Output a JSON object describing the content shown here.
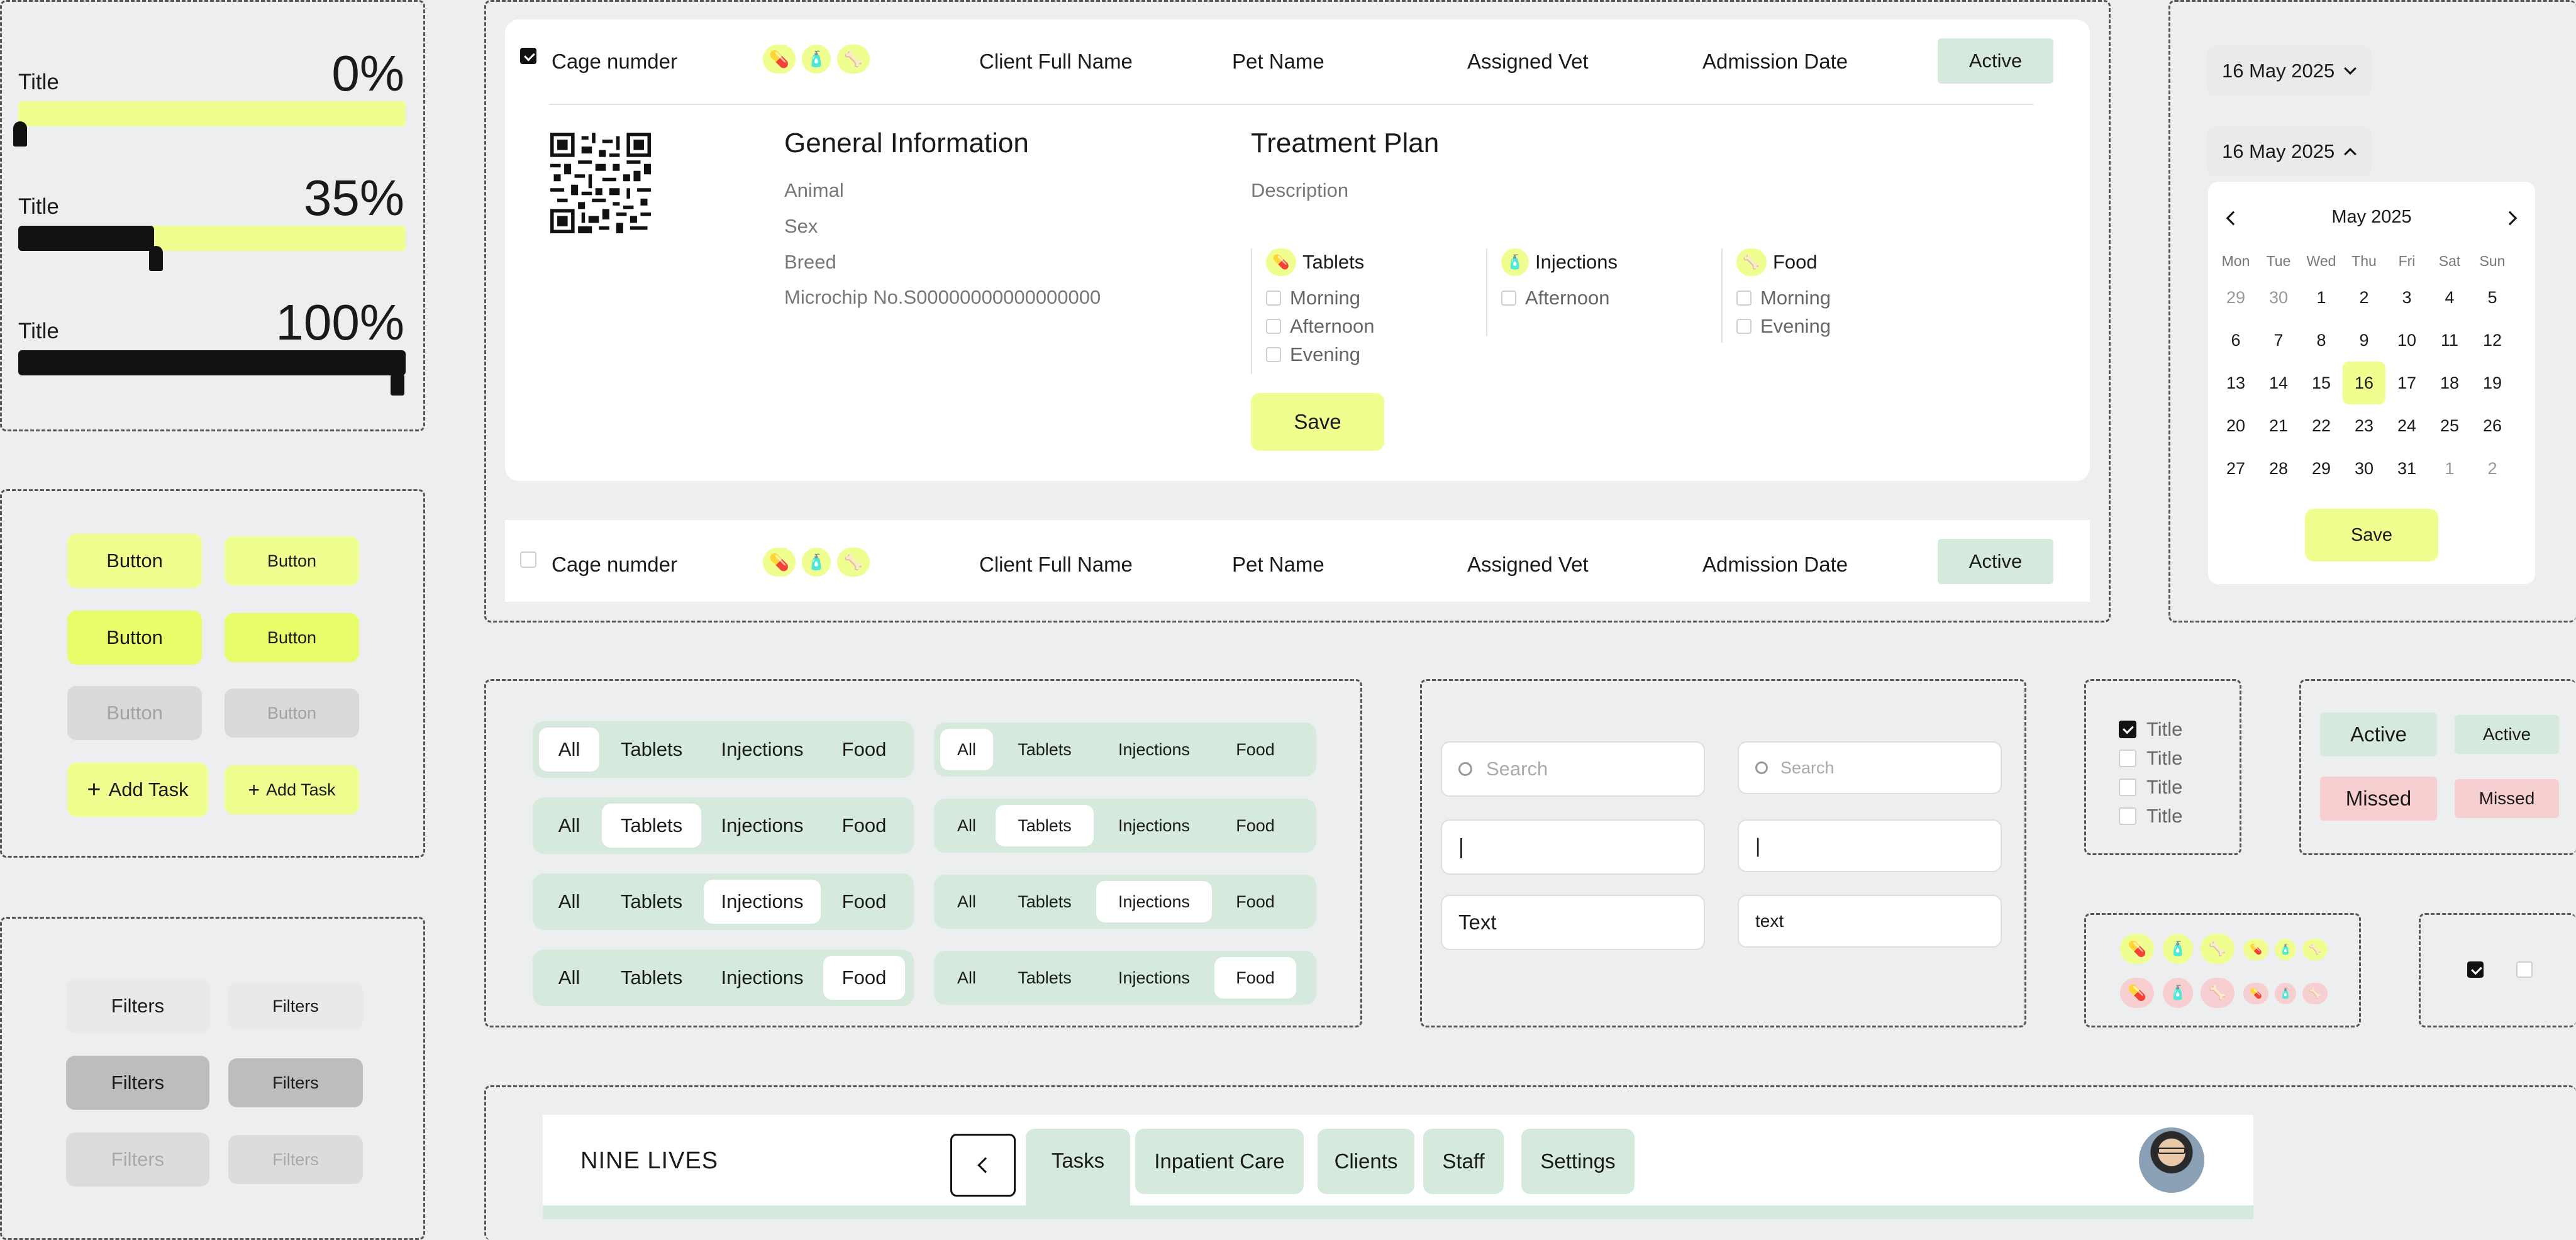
{
  "progress": {
    "bars": [
      {
        "title": "Title",
        "percent_label": "0%",
        "value": 0
      },
      {
        "title": "Title",
        "percent_label": "35%",
        "value": 35
      },
      {
        "title": "Title",
        "percent_label": "100%",
        "value": 100
      }
    ]
  },
  "buttons": {
    "label": "Button",
    "add_task": "Add Task"
  },
  "filters": {
    "label": "Filters"
  },
  "patient_card": {
    "cage_label": "Cage numder",
    "client_col": "Client Full Name",
    "pet_col": "Pet Name",
    "vet_col": "Assigned Vet",
    "date_col": "Admission Date",
    "status": "Active",
    "general_title": "General Information",
    "animal": "Animal",
    "sex": "Sex",
    "breed": "Breed",
    "microchip": "Microchip No.S00000000000000000",
    "treatment_title": "Treatment Plan",
    "description": "Description",
    "tablets_title": "Tablets",
    "tablets_items": [
      "Morning",
      "Afternoon",
      "Evening"
    ],
    "injections_title": "Injections",
    "injections_items": [
      "Afternoon"
    ],
    "food_title": "Food",
    "food_items": [
      "Morning",
      "Evening"
    ],
    "save": "Save"
  },
  "patient_row": {
    "cage_label": "Cage numder",
    "client_col": "Client Full Name",
    "pet_col": "Pet Name",
    "vet_col": "Assigned Vet",
    "date_col": "Admission Date",
    "status": "Active"
  },
  "datepicker": {
    "selected": "16 May 2025",
    "month": "May 2025",
    "weekdays": [
      "Mon",
      "Tue",
      "Wed",
      "Thu",
      "Fri",
      "Sat",
      "Sun"
    ],
    "days": [
      "29",
      "30",
      "1",
      "2",
      "3",
      "4",
      "5",
      "6",
      "7",
      "8",
      "9",
      "10",
      "11",
      "12",
      "13",
      "14",
      "15",
      "16",
      "17",
      "18",
      "19",
      "20",
      "21",
      "22",
      "23",
      "24",
      "25",
      "26",
      "27",
      "28",
      "29",
      "30",
      "31",
      "1",
      "2"
    ],
    "today_index": 17,
    "save": "Save"
  },
  "segments": {
    "options": [
      "All",
      "Tablets",
      "Injections",
      "Food"
    ]
  },
  "inputs": {
    "search_placeholder": "Search",
    "cursor": "|",
    "text_large": "Text",
    "text_small": "text"
  },
  "checklist": {
    "items": [
      "Title",
      "Title",
      "Title",
      "Title"
    ]
  },
  "badges": {
    "active": "Active",
    "missed": "Missed"
  },
  "nav": {
    "brand": "NINE LIVES",
    "tabs": [
      "Tasks",
      "Inpatient Care",
      "Clients",
      "Staff",
      "Settings"
    ],
    "active_tab": "Tasks"
  },
  "colors": {
    "lime": "#effe8f",
    "green": "#d5eadc",
    "pink": "#f7cfd1",
    "black": "#111111"
  }
}
